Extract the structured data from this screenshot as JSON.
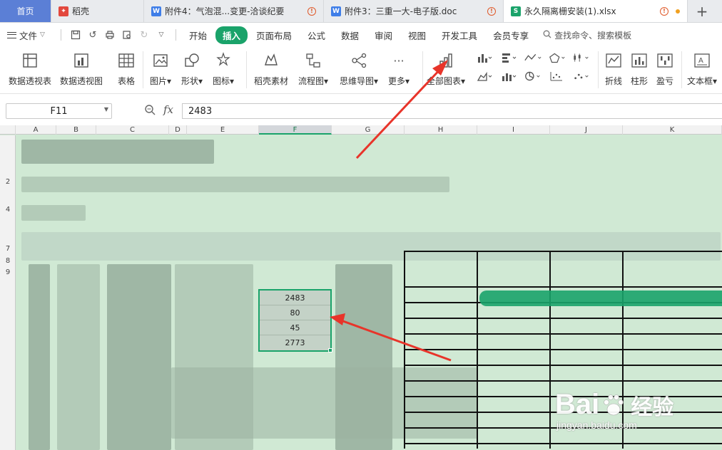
{
  "tabs": [
    {
      "label": "首页",
      "icon": "home"
    },
    {
      "label": "稻壳",
      "icon": "docer-icon",
      "icon_color": "#e2483d"
    },
    {
      "label": "附件4：气泡混...变更-洽谈纪要",
      "icon": "word-icon",
      "icon_color": "#3f7ee8",
      "warning": true
    },
    {
      "label": "附件3：三重一大-电子版.doc",
      "icon": "word-icon",
      "icon_color": "#3f7ee8",
      "warning": true
    },
    {
      "label": "永久隔离栅安装(1).xlsx",
      "icon": "sheet-icon",
      "icon_color": "#1aa36a",
      "warning": true,
      "unsaved": true
    }
  ],
  "new_tab": "+",
  "menu": {
    "file": "文件",
    "items": [
      "开始",
      "插入",
      "页面布局",
      "公式",
      "数据",
      "审阅",
      "视图",
      "开发工具",
      "会员专享"
    ],
    "active": "插入",
    "search": "查找命令、搜索模板"
  },
  "ribbon": {
    "pivot_table": "数据透视表",
    "pivot_chart": "数据透视图",
    "table": "表格",
    "picture": "图片",
    "shape": "形状",
    "icons": "图标",
    "docer_material": "稻壳素材",
    "flowchart": "流程图",
    "mindmap": "思维导图",
    "more": "更多",
    "all_charts": "全部图表",
    "line": "折线",
    "column": "柱形",
    "winloss": "盈亏",
    "textbox": "文本框"
  },
  "formula": {
    "cell_ref": "F11",
    "fx": "fx",
    "value": "2483"
  },
  "columns": [
    "A",
    "B",
    "C",
    "D",
    "E",
    "F",
    "G",
    "H",
    "I",
    "J",
    "K"
  ],
  "selected_column": "F",
  "rows": [
    "2",
    "4",
    "7",
    "8",
    "9"
  ],
  "selected_cells": [
    "2483",
    "80",
    "45",
    "2773"
  ],
  "colors": {
    "accent": "#1aa36a",
    "sheet_bg": "#d0e9d4",
    "arrow": "#e8342a",
    "home_tab": "#5b7fd6"
  },
  "watermark": {
    "brand_left": "Bai",
    "brand_right": "经验",
    "url": "jingyan.baidu.com"
  }
}
